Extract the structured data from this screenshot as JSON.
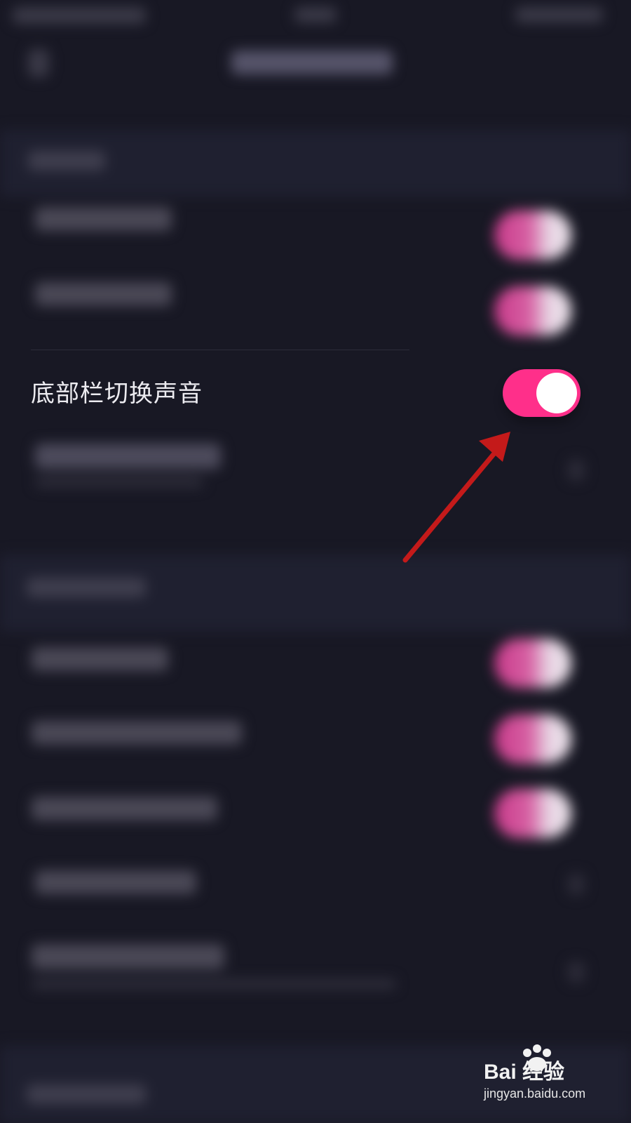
{
  "colors": {
    "background": "#181824",
    "toggle_on": "#ff2f8a",
    "knob": "#ffffff",
    "arrow": "#c41a1a",
    "label": "#ecebf0"
  },
  "setting": {
    "label": "底部栏切换声音",
    "enabled": true
  },
  "annotation": {
    "icon": "arrow-icon"
  },
  "watermark": {
    "brand": "Bai 经验",
    "url": "jingyan.baidu.com"
  }
}
